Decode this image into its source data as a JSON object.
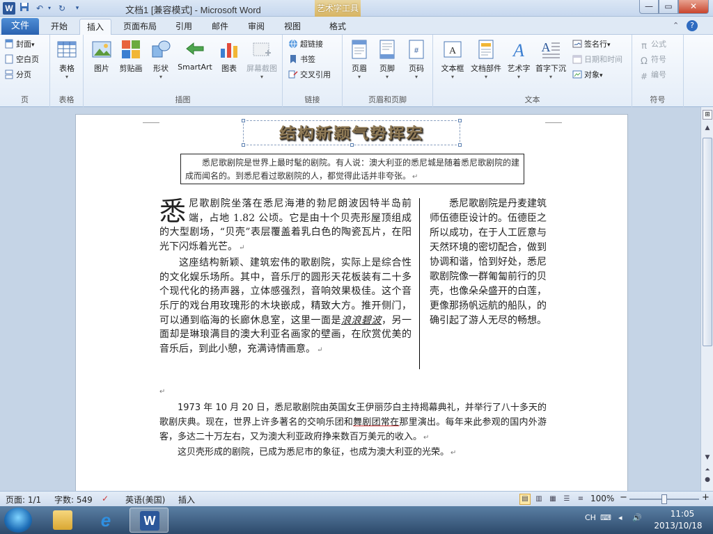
{
  "window": {
    "app_icon": "W",
    "title": "文档1 [兼容模式] - Microsoft Word",
    "context_tab_title": "艺术字工具",
    "controls": {
      "minimize": "—",
      "maximize": "▭",
      "close": "✕"
    }
  },
  "quick_access": {
    "save_icon": "save-icon",
    "undo_icon": "undo-icon",
    "redo_icon": "redo-icon",
    "customize_icon": "customize-icon"
  },
  "ribbon_tabs": {
    "file": "文件",
    "items": [
      "开始",
      "插入",
      "页面布局",
      "引用",
      "邮件",
      "审阅",
      "视图",
      "格式"
    ],
    "active": "插入"
  },
  "groups": {
    "pages": {
      "label": "页",
      "buttons": [
        "封面",
        "空白页",
        "分页"
      ],
      "cover_dropdown": "▾"
    },
    "tables": {
      "label": "表格",
      "button": "表格"
    },
    "illustrations": {
      "label": "插图",
      "buttons": [
        "图片",
        "剪贴画",
        "形状",
        "SmartArt",
        "图表",
        "屏幕截图"
      ]
    },
    "links": {
      "label": "链接",
      "buttons": [
        "超链接",
        "书签",
        "交叉引用"
      ]
    },
    "header_footer": {
      "label": "页眉和页脚",
      "buttons": [
        "页眉",
        "页脚",
        "页码"
      ]
    },
    "text": {
      "label": "文本",
      "buttons": [
        "文本框",
        "文档部件",
        "艺术字",
        "首字下沉"
      ],
      "small": [
        "签名行",
        "日期和时间",
        "对象"
      ]
    },
    "symbols": {
      "label": "符号",
      "small": [
        "公式",
        "符号",
        "编号"
      ]
    }
  },
  "document": {
    "wordart": "结构新颖气势挥宏",
    "intro": "悉尼歌剧院是世界上最时髦的剧院。有人说：澳大利亚的悉尼城是随着悉尼歌剧院的建成而闻名的。到悉尼看过歌剧院的人，都觉得此话并非夸张。",
    "dropcap": "悉",
    "left_p1": "尼歌剧院坐落在悉尼海港的勃尼朗波因特半岛前端，占地 1.82 公顷。它是由十个贝壳形屋顶组成的大型剧场，“贝壳”表层覆盖着乳白色的陶瓷瓦片，在阳光下闪烁着光芒。",
    "left_p2_a": "这座结构新颖、建筑宏伟的歌剧院，实际上是综合性的文化娱乐场所。其中，音乐厅的圆形天花板装有二十多个现代化的扬声器，立体感强烈，音响效果极佳。这个音乐厅的戏台用玫瑰形的木块嵌成，精致大方。推开侧门，可以通到临海的长廊休息室，这里一面是",
    "left_p2_ital": "浪浪碧波",
    "left_p2_b": "，另一面却是琳琅满目的澳大利亚名画家的壁画，在欣赏优美的音乐后，到此小憩，充满诗情画意。",
    "right_col": "悉尼歌剧院是丹麦建筑师伍德臣设计的。伍德臣之所以成功，在于人工匠意与天然环境的密切配合，做到协调和谐，恰到好处，悉尼歌剧院像一群匍匐前行的贝壳，也像朵朵盛开的白莲，更像那扬帆远航的船队，的确引起了游人无尽的畅想。",
    "lower_p1_a": "1973 年 10 月 20 日，悉尼歌剧院由英国女王伊丽莎白主持揭幕典礼，并举行了八十多天的歌剧庆典。现在，世界上许多著名的交响乐团和",
    "lower_p1_u": "舞剧团常在",
    "lower_p1_b": "那里演出。每年来此参观的国内外游客，多达二十万左右，又为澳大利亚政府挣来数百万美元的收入。",
    "lower_p2": "这贝壳形成的剧院，已成为悉尼市的象征，也成为澳大利亚的光荣。",
    "paragraph_mark": "↵"
  },
  "statusbar": {
    "page": "页面: 1/1",
    "words": "字数: 549",
    "language": "英语(美国)",
    "insert_mode": "插入",
    "zoom": "100%",
    "zoom_minus": "−",
    "zoom_plus": "+"
  },
  "taskbar": {
    "word_glyph": "W",
    "ie_glyph": "e",
    "ime": "CH",
    "time": "11:05",
    "date": "2013/10/18"
  },
  "colors": {
    "accent": "#2b579a",
    "file_tab": "#2a62b0",
    "context_tab": "#d7b462"
  }
}
